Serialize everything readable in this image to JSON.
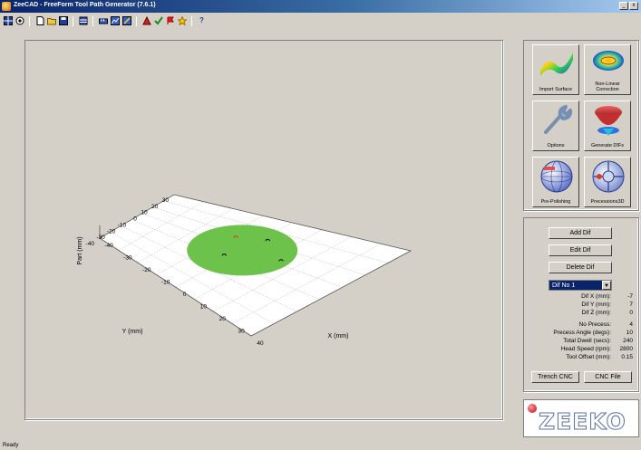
{
  "window": {
    "title": "ZeeCAD - FreeForm Tool Path Generator (7.6.1)"
  },
  "toolbar": {
    "icons": [
      "grid-icon",
      "target-icon",
      "new-file-icon",
      "open-folder-icon",
      "save-icon",
      "layers-icon",
      "measure-icon",
      "chart-icon",
      "zoom-icon",
      "polish-icon",
      "check-icon",
      "flag-icon",
      "star-icon",
      "help-icon"
    ],
    "help_label": "?"
  },
  "plot": {
    "zlabel": "Part (mm)",
    "ylabel": "Y (mm)",
    "xlabel": "X (mm)",
    "x_ticks": [
      "-40",
      "-30",
      "-20",
      "-10",
      "0",
      "10",
      "20",
      "30",
      "40"
    ],
    "y_ticks": [
      "-40",
      "-30",
      "-20",
      "-10",
      "0",
      "10",
      "20",
      "30"
    ],
    "disc_color": "#6cc24a",
    "marker_color": "#000000",
    "active_marker_color": "#e03020"
  },
  "tools": {
    "import_surface": "Import Surface",
    "non_linear_correction": "Non-Linear Correction",
    "options": "Options",
    "generate_difs": "Generate DIFs",
    "pre_polishing": "Pre-Polishing",
    "precessions3d": "Precessions3D"
  },
  "dif": {
    "add": "Add Dif",
    "edit": "Edit Dif",
    "delete": "Delete Dif",
    "selected": "Dif No 1",
    "fields": [
      {
        "label": "Dif X (mm):",
        "value": "-7"
      },
      {
        "label": "Dif Y (mm):",
        "value": "7"
      },
      {
        "label": "Dif Z (mm):",
        "value": "0"
      }
    ],
    "params": [
      {
        "label": "No Precess:",
        "value": "4"
      },
      {
        "label": "Precess Angle (degs):",
        "value": "10"
      },
      {
        "label": "Total Dwell (secs):",
        "value": "240"
      },
      {
        "label": "Head Speed (rpm):",
        "value": "2800"
      },
      {
        "label": "Tool Offset (mm):",
        "value": "0.15"
      }
    ],
    "trench_cnc": "Trench CNC",
    "cnc_file": "CNC File"
  },
  "logo": {
    "text": "ZEEKO"
  },
  "status": {
    "text": "Ready"
  }
}
